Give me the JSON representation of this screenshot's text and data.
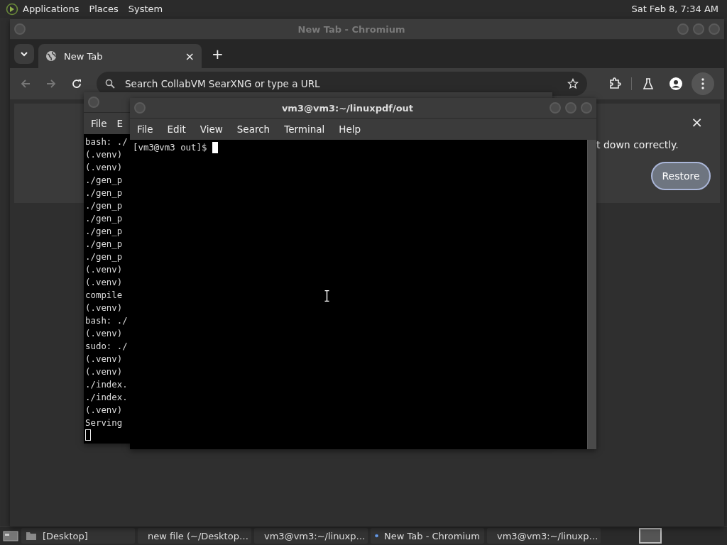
{
  "top_panel": {
    "menus": [
      "Applications",
      "Places",
      "System"
    ],
    "clock": "Sat Feb  8,  7:34 AM"
  },
  "browser": {
    "title": "New Tab - Chromium",
    "tabs": [
      {
        "label": "New Tab",
        "selected": true,
        "close": "×"
      }
    ],
    "new_tab": "+",
    "omnibox": {
      "placeholder": "Search CollabVM SearXNG or type a URL"
    },
    "infobar": {
      "message": "t down correctly.",
      "button": "Restore",
      "close": "×"
    }
  },
  "back_terminal": {
    "menus": [
      "File",
      "E"
    ],
    "lines": [
      "bash: ./",
      "(.venv)",
      "(.venv)",
      "./gen_p",
      "./gen_p",
      "./gen_p",
      "./gen_p",
      "./gen_p",
      "./gen_p",
      "./gen_p",
      "(.venv)",
      "(.venv)",
      "compile",
      "(.venv)",
      "bash: ./",
      "(.venv)",
      "sudo: ./",
      "(.venv)",
      "(.venv)",
      "./index.",
      "./index.",
      "(.venv)",
      "Serving"
    ]
  },
  "front_terminal": {
    "title": "vm3@vm3:~/linuxpdf/out",
    "menus": [
      "File",
      "Edit",
      "View",
      "Search",
      "Terminal",
      "Help"
    ],
    "lines": [
      "[vm3@vm3 out]$ "
    ]
  },
  "taskbar": {
    "items": [
      {
        "kind": "folder",
        "label": "[Desktop]"
      },
      {
        "kind": "editor",
        "label": "new file (~/Desktop…"
      },
      {
        "kind": "terminal",
        "label": "vm3@vm3:~/linuxp…"
      },
      {
        "kind": "browser",
        "label": "New Tab - Chromium"
      },
      {
        "kind": "terminal",
        "label": "vm3@vm3:~/linuxp…"
      }
    ]
  }
}
